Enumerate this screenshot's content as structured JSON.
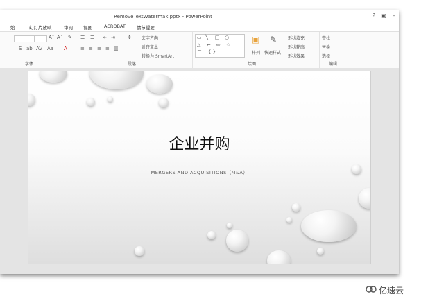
{
  "window": {
    "title": "RemoveTextWatermak.pptx - PowerPoint",
    "help": "?",
    "restore": "□",
    "close": "✕",
    "ribbon_display": "▣"
  },
  "tabs": [
    "始",
    "幻灯片放映",
    "审阅",
    "视图",
    "ACROBAT",
    "情节提要"
  ],
  "ribbon": {
    "font_group_label": "字体",
    "paragraph_group_label": "段落",
    "drawing_group_label": "绘图",
    "editing_group_label": "编辑",
    "text_direction": "文字方向",
    "align_text": "对齐文本",
    "convert_smartart": "转换为 SmartArt",
    "arrange": "排列",
    "quick_styles": "快速样式",
    "shape_fill": "形状填充",
    "shape_outline": "形状轮廓",
    "shape_effects": "形状效果",
    "find": "查找",
    "replace": "替换",
    "select": "选择"
  },
  "slide": {
    "title": "企业并购",
    "subtitle": "MERGERS AND ACQUISITIONS（M&A）"
  },
  "watermark": {
    "text": "亿速云"
  }
}
